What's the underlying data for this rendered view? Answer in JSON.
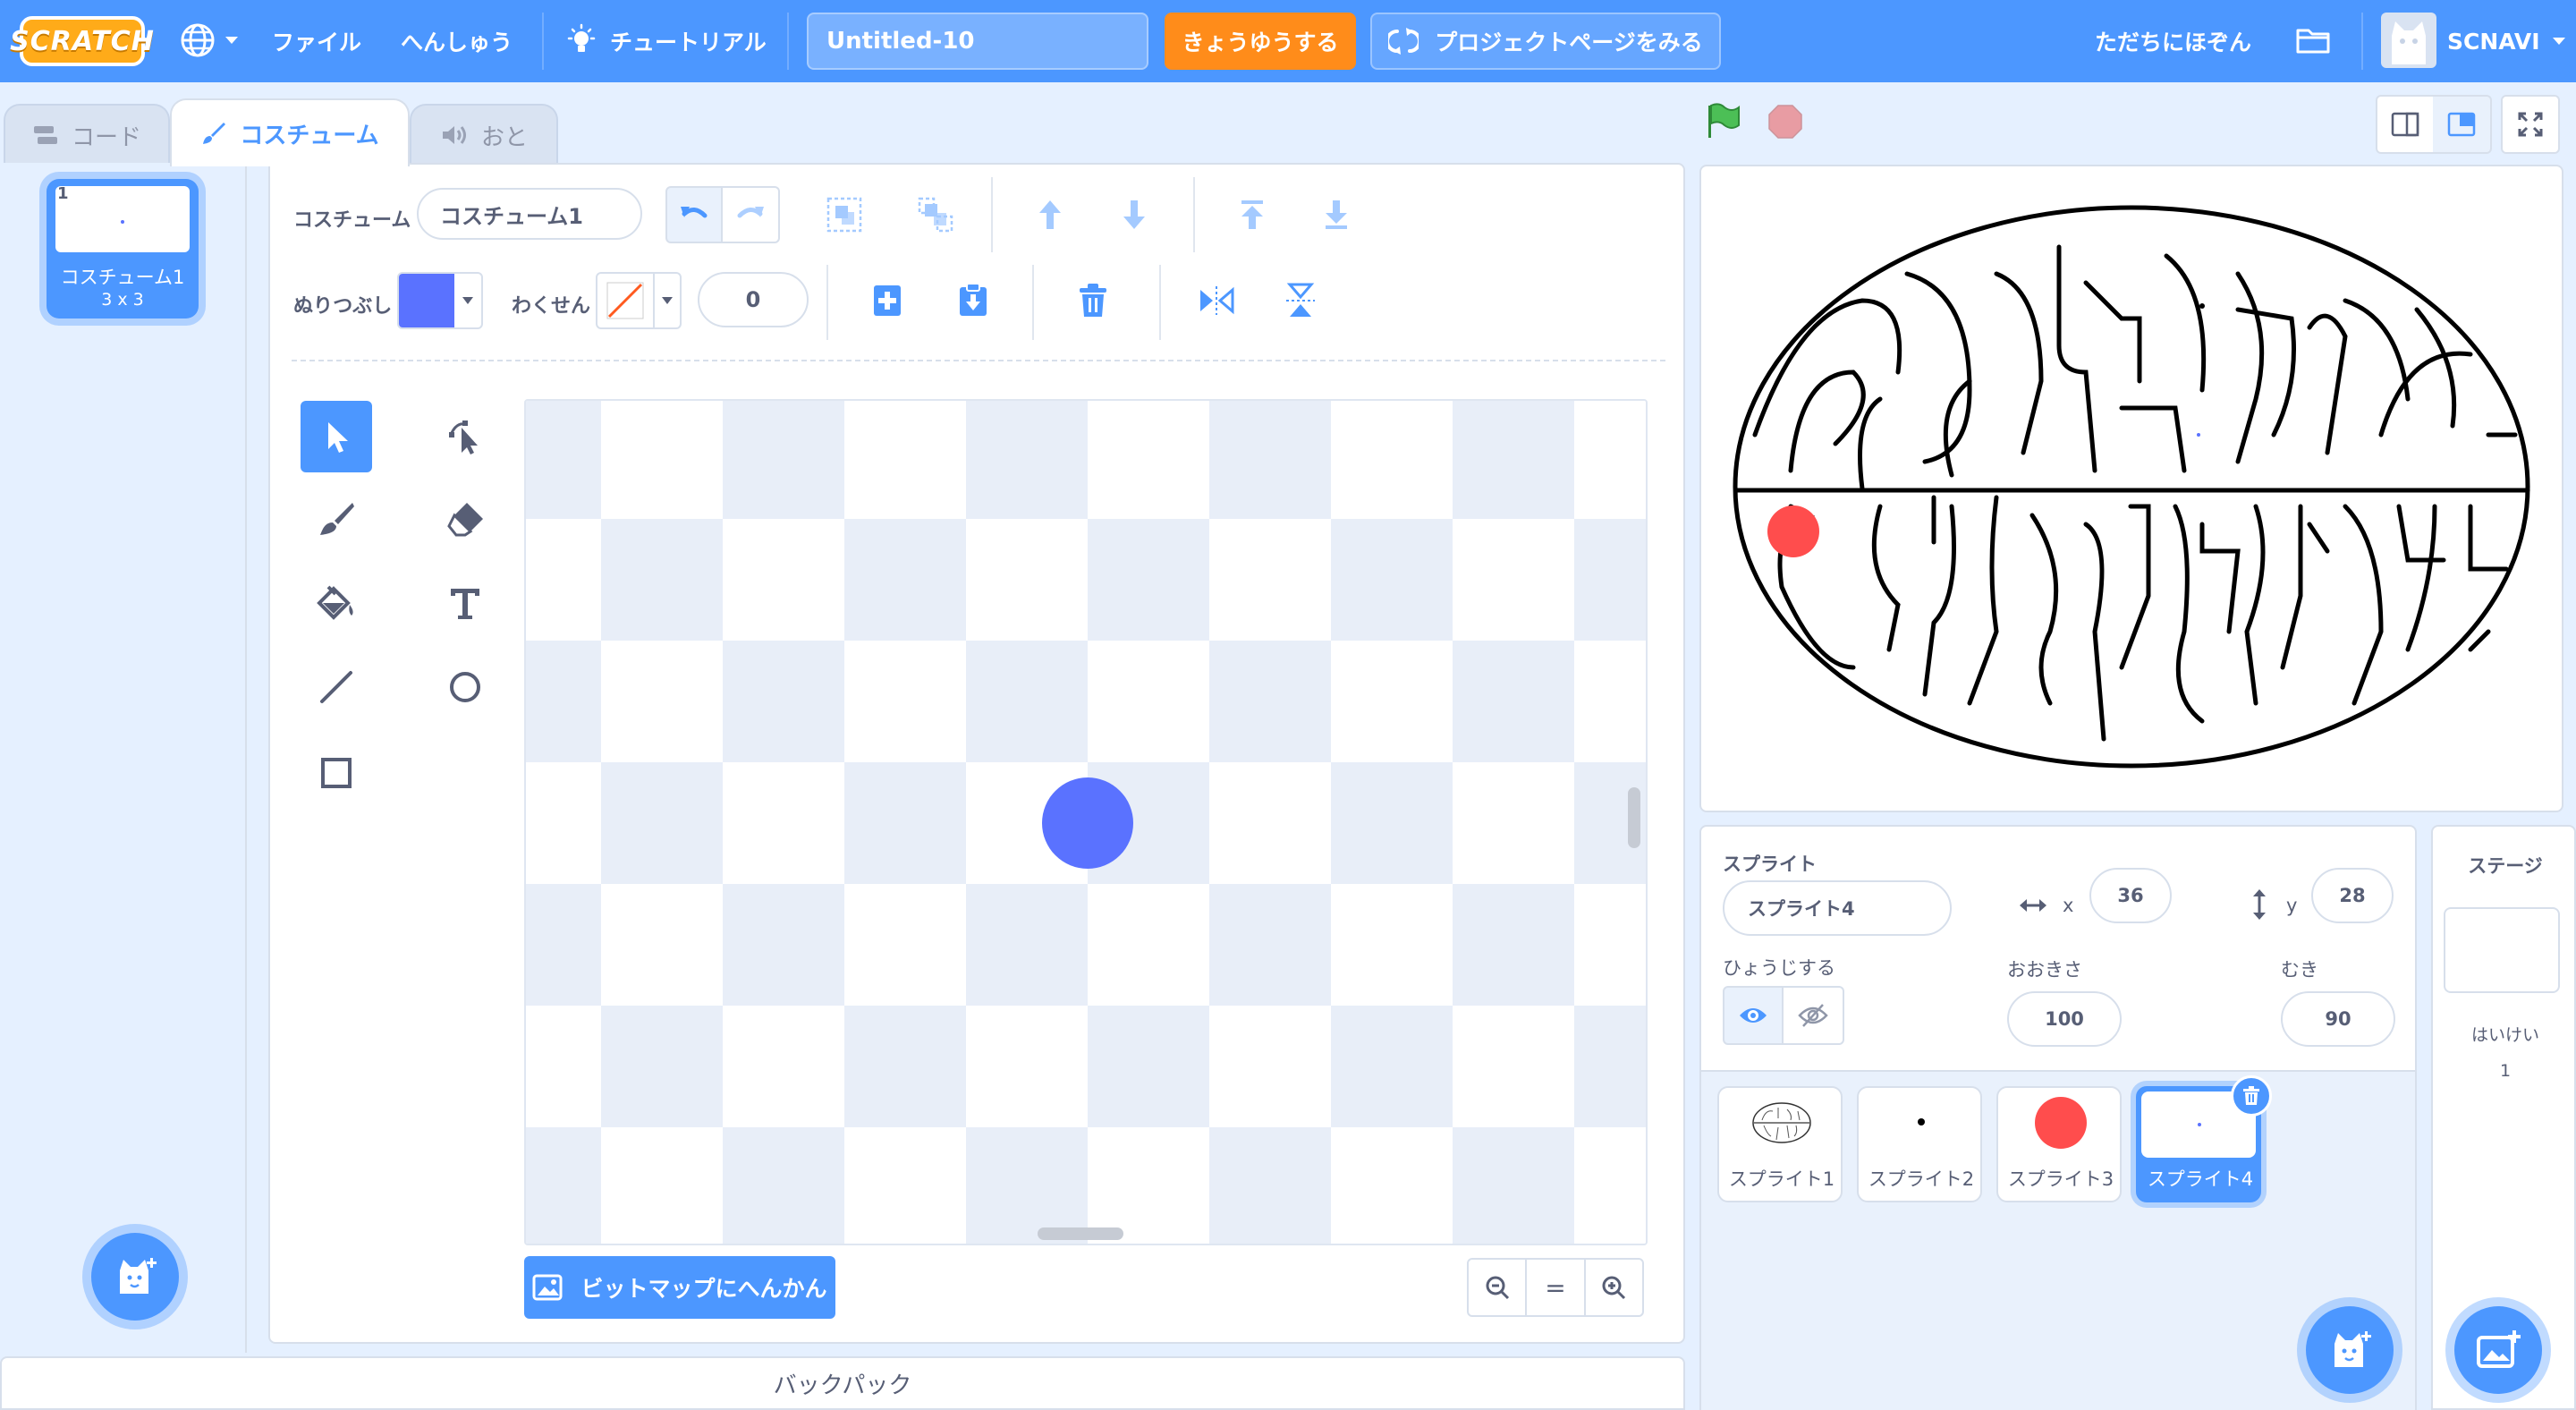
{
  "menubar": {
    "logo": "SCRATCH",
    "language_icon": "globe-icon",
    "file": "ファイル",
    "edit": "へんしゅう",
    "tutorials": "チュートリアル",
    "project_title": "Untitled-10",
    "share": "きょうゆうする",
    "see_project_page": "プロジェクトページをみる",
    "save_now": "ただちにほぞん",
    "username": "SCNAVI"
  },
  "tabs": {
    "code": "コード",
    "costumes": "コスチューム",
    "sounds": "おと"
  },
  "costume_list": {
    "items": [
      {
        "number": "1",
        "name": "コスチューム1",
        "size": "3 x 3"
      }
    ]
  },
  "paint_editor": {
    "costume_label": "コスチューム",
    "costume_name": "コスチューム1",
    "fill_label": "ぬりつぶし",
    "fill_color": "#5a72ff",
    "outline_label": "わくせん",
    "outline_width": "0",
    "convert_button": "ビットマップにへんかん",
    "zoom_out": "－",
    "zoom_reset": "=",
    "zoom_in": "＋",
    "tools": [
      "select",
      "reshape",
      "brush",
      "eraser",
      "fill",
      "text",
      "line",
      "circle",
      "rectangle"
    ],
    "active_tool": "select"
  },
  "backpack": {
    "label": "バックパック"
  },
  "sprite_info": {
    "sprite_label": "スプライト",
    "sprite_name": "スプライト4",
    "x_label": "x",
    "x": "36",
    "y_label": "y",
    "y": "28",
    "show_label": "ひょうじする",
    "size_label": "おおきさ",
    "size": "100",
    "direction_label": "むき",
    "direction": "90"
  },
  "sprites": [
    {
      "name": "スプライト1",
      "thumb": "maze"
    },
    {
      "name": "スプライト2",
      "thumb": "dot"
    },
    {
      "name": "スプライト3",
      "thumb": "red-circle"
    },
    {
      "name": "スプライト4",
      "thumb": "tiny-dot",
      "selected": true
    }
  ],
  "stage_panel": {
    "title": "ステージ",
    "backdrops_label": "はいけい",
    "backdrops_count": "1"
  },
  "colors": {
    "accent": "#4c97ff",
    "share": "#ff8c1a",
    "sprite_red": "#ff4d4d",
    "costume_blue": "#5a72ff",
    "flag_green": "#4cbf56",
    "stop_red": "#ec5959"
  }
}
